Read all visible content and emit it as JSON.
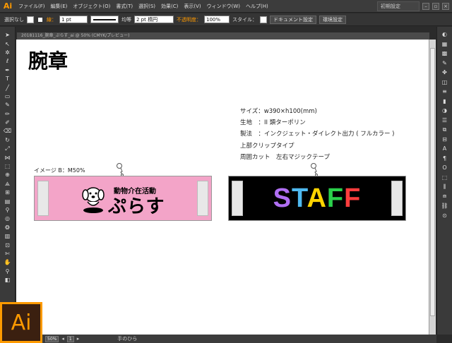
{
  "app": {
    "logo": "Ai",
    "menus": [
      "ファイル(F)",
      "編集(E)",
      "オブジェクト(O)",
      "書式(T)",
      "選択(S)",
      "効果(C)",
      "表示(V)",
      "ウィンドウ(W)",
      "ヘルプ(H)"
    ],
    "workspace_preset": "初期設定"
  },
  "control_bar": {
    "selection": "選択なし",
    "stroke_label": "線：",
    "stroke_weight": "1 pt",
    "stroke_profile": "均等",
    "brush": "2 pt 楕円",
    "opacity_label": "不透明度：",
    "opacity_value": "100%",
    "style_label": "スタイル：",
    "doc_settings_button": "ドキュメント設定",
    "preferences_button": "環境設定"
  },
  "document_tab": {
    "title": "20181116_腕章_ぷらす_ai @ 50% (CMYK/プレビュー)"
  },
  "artboard": {
    "heading": "腕章",
    "specs": [
      "サイズ：w390×h100(mm)",
      "生地　：II 類ターポリン",
      "製法　：インクジェット・ダイレクト出力 ( フルカラー )",
      "上部クリップタイプ",
      "周囲カット　左右マジックテープ"
    ],
    "image_label": "イメージ B：M50%",
    "pink_band": {
      "subtitle": "動物介在活動",
      "main_text": "ぷらす",
      "color": "#f3a4c8"
    },
    "black_band": {
      "letters": [
        {
          "char": "S",
          "color": "#b06ff3"
        },
        {
          "char": "T",
          "color": "#4fb9f0"
        },
        {
          "char": "A",
          "color": "#ffd400"
        },
        {
          "char": "F",
          "color": "#2bd14b"
        },
        {
          "char": "F",
          "color": "#ff3d3d"
        }
      ]
    }
  },
  "status_bar": {
    "zoom": "50%",
    "page": "1",
    "tool_name": "手のひら"
  },
  "brand": {
    "big_logo": "Ai",
    "accent": "#ff9a00"
  }
}
